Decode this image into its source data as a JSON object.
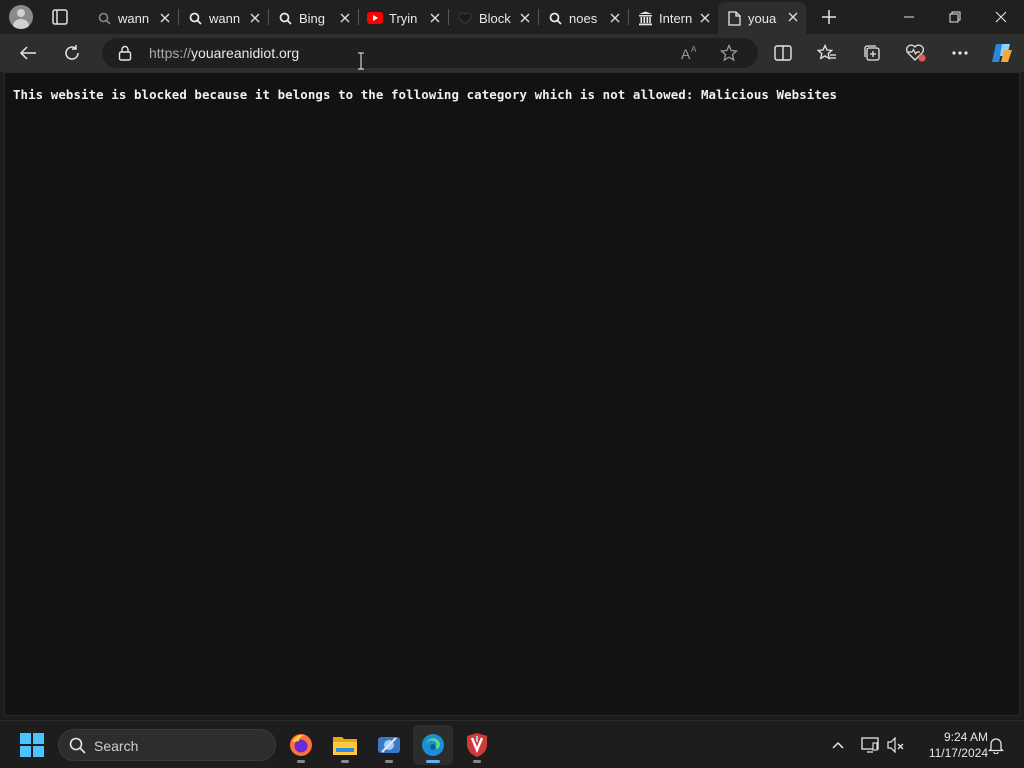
{
  "browser": {
    "tabs": [
      {
        "title": "wann",
        "favicon": "search-icon",
        "active": false
      },
      {
        "title": "wann",
        "favicon": "search-icon",
        "active": false
      },
      {
        "title": "Bing",
        "favicon": "search-icon",
        "active": false
      },
      {
        "title": "Tryin",
        "favicon": "youtube-icon",
        "active": false
      },
      {
        "title": "Block",
        "favicon": "heart-icon",
        "active": false
      },
      {
        "title": "noes",
        "favicon": "search-icon",
        "active": false
      },
      {
        "title": "Intern",
        "favicon": "archive-icon",
        "active": false
      },
      {
        "title": "youa",
        "favicon": "page-icon",
        "active": true
      }
    ],
    "address": {
      "scheme": "https://",
      "host": "youareanidiot.org"
    }
  },
  "page": {
    "message": "This website is blocked because it belongs to the following category which is not allowed: Malicious Websites"
  },
  "taskbar": {
    "search_label": "Search",
    "apps": [
      "firefox-icon",
      "file-explorer-icon",
      "app-icon",
      "edge-icon",
      "security-app-icon"
    ],
    "time": "9:24 AM",
    "date": "11/17/2024"
  },
  "colors": {
    "page_bg": "#121212",
    "toolbar_bg": "#2e2e2e",
    "tabstrip_bg": "#202020",
    "taskbar_bg": "#1d1d1d",
    "accent": "#5fb2f2",
    "youtube_red": "#ff0000"
  }
}
